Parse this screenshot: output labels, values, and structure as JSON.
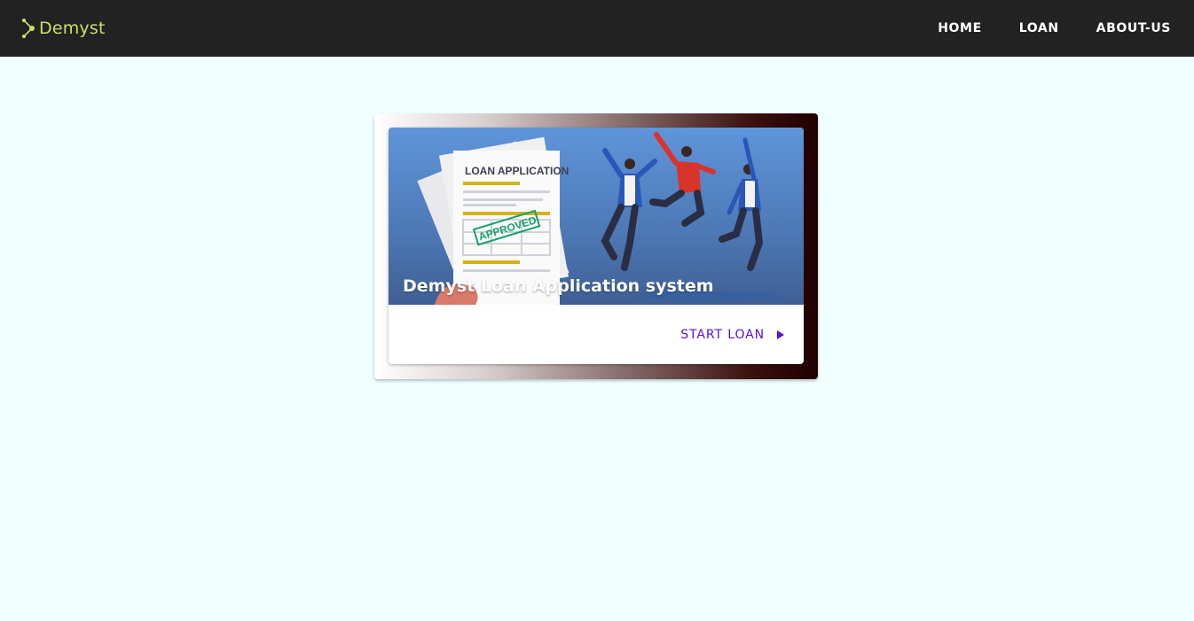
{
  "navbar": {
    "brand": "Demyst",
    "brand_color": "#c9e265",
    "links": [
      {
        "label": "HOME"
      },
      {
        "label": "LOAN"
      },
      {
        "label": "ABOUT-US"
      }
    ]
  },
  "card": {
    "image_heading": "LOAN APPLICATION",
    "image_stamp": "APPROVED",
    "title": "Demyst Loan Application system",
    "action_label": "START LOAN",
    "action_icon": "play-arrow-icon",
    "action_color": "#5b10d6"
  }
}
